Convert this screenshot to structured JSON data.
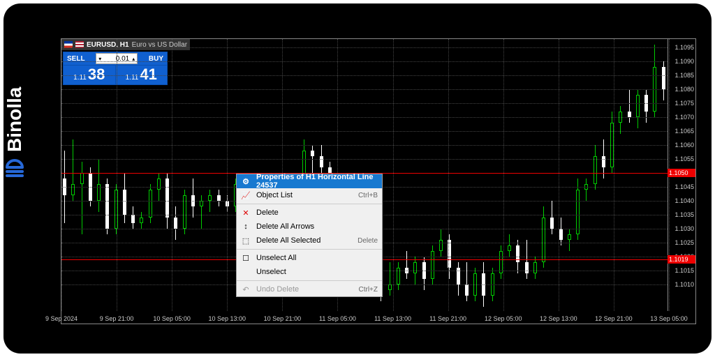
{
  "brand": {
    "name": "Binolla"
  },
  "chart_header": {
    "symbol": "EURUSD, H1",
    "description": "Euro vs US Dollar"
  },
  "trade_panel": {
    "sell_label": "SELL",
    "buy_label": "BUY",
    "volume": "0.01",
    "sell_prefix": "1.11",
    "sell_big": "38",
    "buy_prefix": "1.11",
    "buy_big": "41"
  },
  "context_menu": {
    "items": [
      {
        "icon": "⚙",
        "label": "Properties of H1 Horizontal Line 24537",
        "shortcut": "",
        "highlighted": true
      },
      {
        "icon": "📈",
        "label": "Object List",
        "shortcut": "Ctrl+B"
      },
      {
        "sep": true
      },
      {
        "icon": "✕",
        "label": "Delete",
        "shortcut": "",
        "red": true
      },
      {
        "icon": "↕",
        "label": "Delete All Arrows",
        "shortcut": ""
      },
      {
        "icon": "⬚",
        "label": "Delete All Selected",
        "shortcut": "Delete"
      },
      {
        "sep": true
      },
      {
        "icon": "☐",
        "label": "Unselect All",
        "shortcut": ""
      },
      {
        "icon": "",
        "label": "Unselect",
        "shortcut": ""
      },
      {
        "sep": true
      },
      {
        "icon": "↶",
        "label": "Undo Delete",
        "shortcut": "Ctrl+Z",
        "disabled": true
      }
    ]
  },
  "horizontal_lines": [
    {
      "price": 1.105,
      "label": "1.1050"
    },
    {
      "price": 1.1019,
      "label": "1.1019"
    }
  ],
  "chart_data": {
    "type": "candlestick",
    "title": "EURUSD H1",
    "xlabel": "",
    "ylabel": "",
    "ylim": [
      1.1,
      1.1098
    ],
    "y_ticks": [
      1.101,
      1.1015,
      1.102,
      1.1025,
      1.103,
      1.1035,
      1.104,
      1.1045,
      1.105,
      1.1055,
      1.106,
      1.1065,
      1.107,
      1.1075,
      1.108,
      1.1085,
      1.109,
      1.1095
    ],
    "x_ticks": [
      "9 Sep 2024",
      "9 Sep 21:00",
      "10 Sep 05:00",
      "10 Sep 13:00",
      "10 Sep 21:00",
      "11 Sep 05:00",
      "11 Sep 13:00",
      "11 Sep 21:00",
      "12 Sep 05:00",
      "12 Sep 13:00",
      "12 Sep 21:00",
      "13 Sep 05:00"
    ],
    "series": [
      {
        "o": 1.1048,
        "h": 1.1058,
        "l": 1.1032,
        "c": 1.1042,
        "dir": "down"
      },
      {
        "o": 1.1042,
        "h": 1.1062,
        "l": 1.104,
        "c": 1.1046,
        "dir": "up"
      },
      {
        "o": 1.1046,
        "h": 1.1054,
        "l": 1.1028,
        "c": 1.105,
        "dir": "up"
      },
      {
        "o": 1.105,
        "h": 1.1052,
        "l": 1.1038,
        "c": 1.104,
        "dir": "down"
      },
      {
        "o": 1.104,
        "h": 1.1055,
        "l": 1.1036,
        "c": 1.1046,
        "dir": "up"
      },
      {
        "o": 1.1046,
        "h": 1.1048,
        "l": 1.1028,
        "c": 1.103,
        "dir": "down"
      },
      {
        "o": 1.103,
        "h": 1.1046,
        "l": 1.1028,
        "c": 1.1044,
        "dir": "up"
      },
      {
        "o": 1.1044,
        "h": 1.105,
        "l": 1.1032,
        "c": 1.1035,
        "dir": "down"
      },
      {
        "o": 1.1035,
        "h": 1.1038,
        "l": 1.103,
        "c": 1.1032,
        "dir": "down"
      },
      {
        "o": 1.1032,
        "h": 1.1036,
        "l": 1.103,
        "c": 1.1034,
        "dir": "up"
      },
      {
        "o": 1.1034,
        "h": 1.1046,
        "l": 1.1032,
        "c": 1.1044,
        "dir": "up"
      },
      {
        "o": 1.1044,
        "h": 1.105,
        "l": 1.104,
        "c": 1.1048,
        "dir": "up"
      },
      {
        "o": 1.1048,
        "h": 1.105,
        "l": 1.103,
        "c": 1.1034,
        "dir": "down"
      },
      {
        "o": 1.1034,
        "h": 1.1038,
        "l": 1.1026,
        "c": 1.103,
        "dir": "down"
      },
      {
        "o": 1.103,
        "h": 1.1044,
        "l": 1.1028,
        "c": 1.1042,
        "dir": "up"
      },
      {
        "o": 1.1042,
        "h": 1.1048,
        "l": 1.1034,
        "c": 1.1038,
        "dir": "down"
      },
      {
        "o": 1.1038,
        "h": 1.1042,
        "l": 1.103,
        "c": 1.104,
        "dir": "up"
      },
      {
        "o": 1.104,
        "h": 1.1044,
        "l": 1.1036,
        "c": 1.1042,
        "dir": "up"
      },
      {
        "o": 1.1042,
        "h": 1.1044,
        "l": 1.1038,
        "c": 1.104,
        "dir": "down"
      },
      {
        "o": 1.104,
        "h": 1.1042,
        "l": 1.1036,
        "c": 1.1038,
        "dir": "down"
      },
      {
        "o": 1.1038,
        "h": 1.1048,
        "l": 1.1036,
        "c": 1.1046,
        "dir": "up"
      },
      {
        "o": 1.1046,
        "h": 1.105,
        "l": 1.1042,
        "c": 1.1048,
        "dir": "up"
      },
      {
        "o": 1.1048,
        "h": 1.105,
        "l": 1.104,
        "c": 1.1044,
        "dir": "down"
      },
      {
        "o": 1.1044,
        "h": 1.1048,
        "l": 1.1042,
        "c": 1.1046,
        "dir": "up"
      },
      {
        "o": 1.1046,
        "h": 1.105,
        "l": 1.1044,
        "c": 1.1048,
        "dir": "up"
      },
      {
        "o": 1.1048,
        "h": 1.105,
        "l": 1.1038,
        "c": 1.1042,
        "dir": "down"
      },
      {
        "o": 1.1042,
        "h": 1.1046,
        "l": 1.1034,
        "c": 1.1038,
        "dir": "down"
      },
      {
        "o": 1.1038,
        "h": 1.1044,
        "l": 1.1036,
        "c": 1.1042,
        "dir": "up"
      },
      {
        "o": 1.1042,
        "h": 1.1062,
        "l": 1.104,
        "c": 1.1058,
        "dir": "up"
      },
      {
        "o": 1.1058,
        "h": 1.106,
        "l": 1.103,
        "c": 1.1056,
        "dir": "down"
      },
      {
        "o": 1.1056,
        "h": 1.106,
        "l": 1.1048,
        "c": 1.1052,
        "dir": "down"
      },
      {
        "o": 1.1052,
        "h": 1.1054,
        "l": 1.104,
        "c": 1.1044,
        "dir": "down"
      },
      {
        "o": 1.1044,
        "h": 1.1048,
        "l": 1.1038,
        "c": 1.1042,
        "dir": "down"
      },
      {
        "o": 1.1042,
        "h": 1.105,
        "l": 1.104,
        "c": 1.1048,
        "dir": "up"
      },
      {
        "o": 1.1048,
        "h": 1.105,
        "l": 1.104,
        "c": 1.1044,
        "dir": "down"
      },
      {
        "o": 1.1044,
        "h": 1.1046,
        "l": 1.101,
        "c": 1.1016,
        "dir": "down"
      },
      {
        "o": 1.1016,
        "h": 1.1024,
        "l": 1.1014,
        "c": 1.102,
        "dir": "up"
      },
      {
        "o": 1.102,
        "h": 1.1026,
        "l": 1.1004,
        "c": 1.1008,
        "dir": "down"
      },
      {
        "o": 1.1008,
        "h": 1.1018,
        "l": 1.1006,
        "c": 1.101,
        "dir": "up"
      },
      {
        "o": 1.101,
        "h": 1.1018,
        "l": 1.1008,
        "c": 1.1016,
        "dir": "up"
      },
      {
        "o": 1.1016,
        "h": 1.1022,
        "l": 1.1012,
        "c": 1.1014,
        "dir": "down"
      },
      {
        "o": 1.1014,
        "h": 1.102,
        "l": 1.101,
        "c": 1.1018,
        "dir": "up"
      },
      {
        "o": 1.1018,
        "h": 1.102,
        "l": 1.1008,
        "c": 1.1012,
        "dir": "down"
      },
      {
        "o": 1.1012,
        "h": 1.1024,
        "l": 1.101,
        "c": 1.1022,
        "dir": "up"
      },
      {
        "o": 1.1022,
        "h": 1.103,
        "l": 1.102,
        "c": 1.1026,
        "dir": "up"
      },
      {
        "o": 1.1026,
        "h": 1.1028,
        "l": 1.1012,
        "c": 1.1016,
        "dir": "down"
      },
      {
        "o": 1.1016,
        "h": 1.1018,
        "l": 1.1006,
        "c": 1.101,
        "dir": "down"
      },
      {
        "o": 1.101,
        "h": 1.1018,
        "l": 1.1004,
        "c": 1.1006,
        "dir": "down"
      },
      {
        "o": 1.1006,
        "h": 1.1016,
        "l": 1.1004,
        "c": 1.1014,
        "dir": "up"
      },
      {
        "o": 1.1014,
        "h": 1.1018,
        "l": 1.1002,
        "c": 1.1006,
        "dir": "down"
      },
      {
        "o": 1.1006,
        "h": 1.1016,
        "l": 1.1004,
        "c": 1.1014,
        "dir": "up"
      },
      {
        "o": 1.1014,
        "h": 1.1024,
        "l": 1.1012,
        "c": 1.1022,
        "dir": "up"
      },
      {
        "o": 1.1022,
        "h": 1.1028,
        "l": 1.102,
        "c": 1.1024,
        "dir": "up"
      },
      {
        "o": 1.1024,
        "h": 1.1026,
        "l": 1.1014,
        "c": 1.1018,
        "dir": "down"
      },
      {
        "o": 1.1018,
        "h": 1.1026,
        "l": 1.1012,
        "c": 1.1014,
        "dir": "down"
      },
      {
        "o": 1.1014,
        "h": 1.102,
        "l": 1.1012,
        "c": 1.1018,
        "dir": "up"
      },
      {
        "o": 1.1018,
        "h": 1.1038,
        "l": 1.1016,
        "c": 1.1034,
        "dir": "up"
      },
      {
        "o": 1.1034,
        "h": 1.104,
        "l": 1.1028,
        "c": 1.103,
        "dir": "down"
      },
      {
        "o": 1.103,
        "h": 1.1034,
        "l": 1.1024,
        "c": 1.1026,
        "dir": "down"
      },
      {
        "o": 1.1026,
        "h": 1.103,
        "l": 1.1022,
        "c": 1.1028,
        "dir": "up"
      },
      {
        "o": 1.1028,
        "h": 1.1048,
        "l": 1.1026,
        "c": 1.1044,
        "dir": "up"
      },
      {
        "o": 1.1044,
        "h": 1.1048,
        "l": 1.104,
        "c": 1.1046,
        "dir": "up"
      },
      {
        "o": 1.1046,
        "h": 1.106,
        "l": 1.1044,
        "c": 1.1056,
        "dir": "up"
      },
      {
        "o": 1.1056,
        "h": 1.1062,
        "l": 1.1048,
        "c": 1.1052,
        "dir": "down"
      },
      {
        "o": 1.1052,
        "h": 1.1072,
        "l": 1.105,
        "c": 1.1068,
        "dir": "up"
      },
      {
        "o": 1.1068,
        "h": 1.1074,
        "l": 1.1064,
        "c": 1.1072,
        "dir": "up"
      },
      {
        "o": 1.1072,
        "h": 1.108,
        "l": 1.1068,
        "c": 1.107,
        "dir": "down"
      },
      {
        "o": 1.107,
        "h": 1.108,
        "l": 1.1066,
        "c": 1.1078,
        "dir": "up"
      },
      {
        "o": 1.1078,
        "h": 1.108,
        "l": 1.1068,
        "c": 1.1072,
        "dir": "down"
      },
      {
        "o": 1.1072,
        "h": 1.1096,
        "l": 1.107,
        "c": 1.1088,
        "dir": "up"
      },
      {
        "o": 1.1088,
        "h": 1.109,
        "l": 1.1076,
        "c": 1.108,
        "dir": "down"
      }
    ]
  }
}
